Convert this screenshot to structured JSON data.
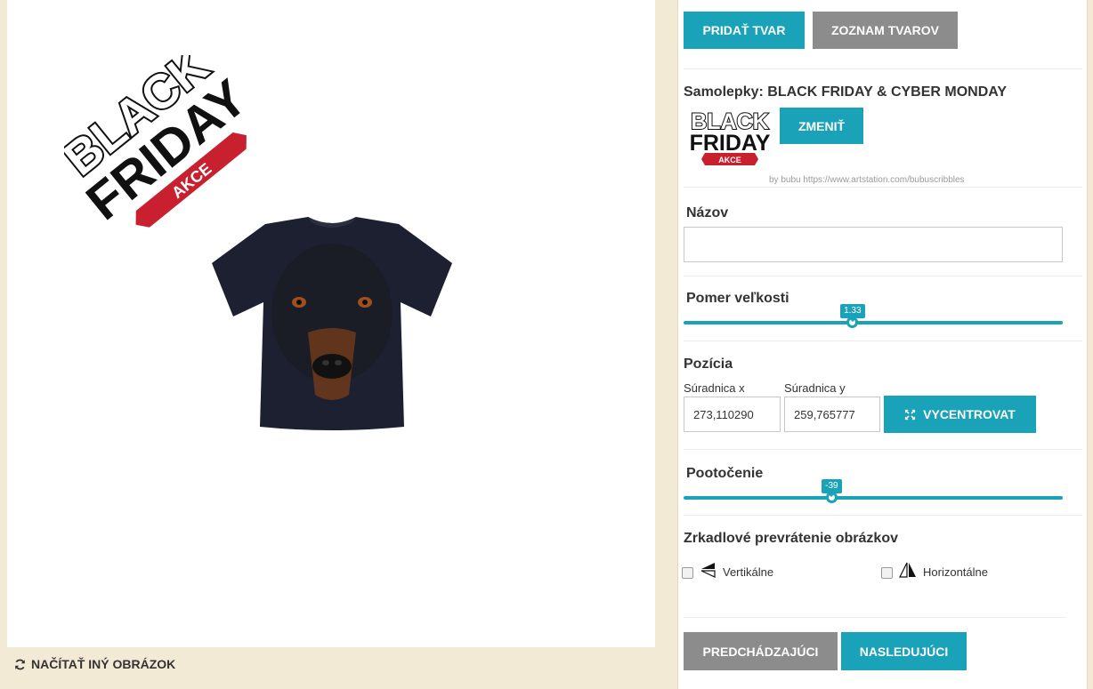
{
  "canvas": {
    "sticker_line1": "BLACK",
    "sticker_line2": "FRIDAY",
    "sticker_ribbon": "AKCE",
    "reload_label": "NAČÍTAŤ INÝ OBRÁZOK"
  },
  "panel": {
    "add_shape_label": "PRIDAŤ TVAR",
    "shape_list_label": "ZOZNAM TVAROV",
    "sticker_section": {
      "title": "Samolepky: BLACK FRIDAY & CYBER MONDAY",
      "thumb_line1": "BLACK",
      "thumb_line2": "FRIDAY",
      "thumb_ribbon": "AKCE",
      "change_label": "ZMENIŤ",
      "credit": "by bubu https://www.artstation.com/bubuscribbles"
    },
    "name_section": {
      "title": "Názov",
      "value": ""
    },
    "scale_section": {
      "title": "Pomer veľkosti",
      "value": "1.33",
      "fraction": 0.445
    },
    "position_section": {
      "title": "Pozícia",
      "x_label": "Súradnica x",
      "x_value": "273,110290",
      "y_label": "Súradnica y",
      "y_value": "259,765777",
      "center_label": "VYCENTROVAT"
    },
    "rotation_section": {
      "title": "Pootočenie",
      "value": "-39",
      "fraction": 0.39
    },
    "mirror_section": {
      "title": "Zrkadlové prevrátenie obrázkov",
      "vertical_label": "Vertikálne",
      "horizontal_label": "Horizontálne"
    },
    "prev_label": "PREDCHÁDZAJÚCI",
    "next_label": "NASLEDUJÚCI"
  },
  "colors": {
    "accent": "#1aa2b8",
    "secondary": "#8c8c8c",
    "background": "#f3ead6",
    "ribbon": "#c8202e"
  }
}
